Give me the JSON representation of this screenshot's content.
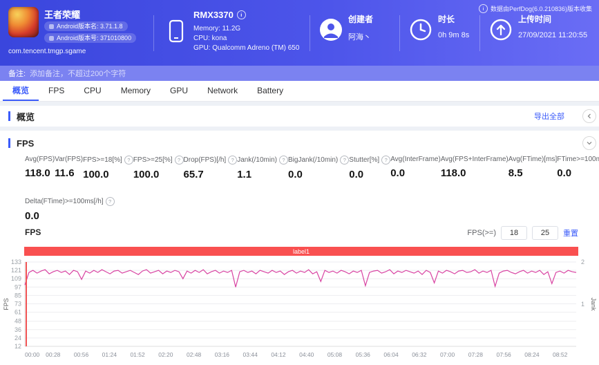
{
  "header": {
    "app": {
      "name": "王者荣耀",
      "version_name": "Android版本名: 3.71.1.8",
      "version_code": "Android版本号: 371010800",
      "package": "com.tencent.tmgp.sgame"
    },
    "device": {
      "model": "RMX3370",
      "memory": "Memory: 11.2G",
      "cpu": "CPU: kona",
      "gpu": "GPU: Qualcomm Adreno (TM) 650"
    },
    "creator": {
      "label": "创建者",
      "value": "阿海丶"
    },
    "duration": {
      "label": "时长",
      "value": "0h 9m 8s"
    },
    "upload": {
      "label": "上传时间",
      "value": "27/09/2021 11:20:55"
    },
    "collect_info": "数据由PerfDog(6.0.210836)版本收集"
  },
  "note": {
    "label": "备注:",
    "placeholder": "添加备注，不超过200个字符"
  },
  "tabs": {
    "items": [
      {
        "label": "概览",
        "active": true
      },
      {
        "label": "FPS",
        "active": false
      },
      {
        "label": "CPU",
        "active": false
      },
      {
        "label": "Memory",
        "active": false
      },
      {
        "label": "GPU",
        "active": false
      },
      {
        "label": "Network",
        "active": false
      },
      {
        "label": "Battery",
        "active": false
      }
    ]
  },
  "overview": {
    "title": "概览",
    "export_label": "导出全部"
  },
  "fps_section": {
    "title": "FPS",
    "metrics_rows": [
      [
        {
          "label": "Avg(FPS)",
          "value": "118.0",
          "info": false
        },
        {
          "label": "Var(FPS)",
          "value": "11.6",
          "info": false
        },
        {
          "label": "FPS>=18[%]",
          "value": "100.0",
          "info": true
        },
        {
          "label": "FPS>=25[%]",
          "value": "100.0",
          "info": true
        },
        {
          "label": "Drop(FPS)[/h]",
          "value": "65.7",
          "info": true
        },
        {
          "label": "Jank(/10min)",
          "value": "1.1",
          "info": true
        },
        {
          "label": "BigJank(/10min)",
          "value": "0.0",
          "info": true
        },
        {
          "label": "Stutter[%]",
          "value": "0.0",
          "info": true
        },
        {
          "label": "Avg(InterFrame)",
          "value": "0.0",
          "info": false
        },
        {
          "label": "Avg(FPS+InterFrame)",
          "value": "118.0",
          "info": false
        },
        {
          "label": "Avg(FTime)[ms]",
          "value": "8.5",
          "info": false
        },
        {
          "label": "FTime>=100ms[%]",
          "value": "0.0",
          "info": false
        }
      ],
      [
        {
          "label": "Delta(FTime)>=100ms[/h]",
          "value": "0.0",
          "info": true
        }
      ]
    ],
    "controls": {
      "label": "FPS(>=)",
      "threshold1": "18",
      "threshold2": "25",
      "reset_label": "重置"
    }
  },
  "chart_data": {
    "type": "line",
    "title": "FPS",
    "banner_label": "label1",
    "y_left": {
      "label": "FPS",
      "min": 12,
      "max": 133,
      "ticks": [
        133,
        121,
        109,
        97,
        85,
        73,
        61,
        48,
        36,
        24,
        12
      ]
    },
    "y_right": {
      "label": "Jank",
      "min": 0,
      "max": 2,
      "ticks": [
        2,
        1
      ]
    },
    "x_domain_s": [
      0,
      548
    ],
    "x_tick_interval_s": 28,
    "x_ticks": [
      "00:00",
      "00:28",
      "00:56",
      "01:24",
      "01:52",
      "02:20",
      "02:48",
      "03:16",
      "03:44",
      "04:12",
      "04:40",
      "05:08",
      "05:36",
      "06:04",
      "06:32",
      "07:00",
      "07:28",
      "07:56",
      "08:24",
      "08:52"
    ],
    "cursor_time": "00:00",
    "series": [
      {
        "name": "FPS",
        "color": "#d843a2",
        "values": [
          100,
          118,
          121,
          117,
          120,
          122,
          116,
          119,
          121,
          118,
          120,
          115,
          121,
          119,
          108,
          120,
          117,
          121,
          118,
          122,
          119,
          116,
          120,
          121,
          117,
          119,
          121,
          118,
          115,
          120,
          122,
          117,
          119,
          121,
          116,
          120,
          118,
          121,
          119,
          109,
          120,
          117,
          121,
          118,
          122,
          116,
          119,
          121,
          117,
          120,
          118,
          121,
          97,
          119,
          121,
          118,
          120,
          116,
          121,
          119,
          117,
          121,
          118,
          120,
          115,
          119,
          121,
          117,
          120,
          118,
          122,
          116,
          119,
          105,
          121,
          118,
          120,
          117,
          121,
          119,
          116,
          120,
          118,
          121,
          99,
          118,
          120,
          121,
          117,
          119,
          122,
          116,
          120,
          118,
          121,
          119,
          117,
          120,
          115,
          121,
          118,
          103,
          120,
          117,
          121,
          119,
          116,
          120,
          121,
          118,
          119,
          122,
          117,
          120,
          118,
          121,
          98,
          117,
          120,
          121,
          118,
          116,
          119,
          121,
          117,
          120,
          118,
          121,
          115,
          119,
          102,
          118,
          120,
          117,
          121,
          119,
          118
        ]
      }
    ]
  }
}
